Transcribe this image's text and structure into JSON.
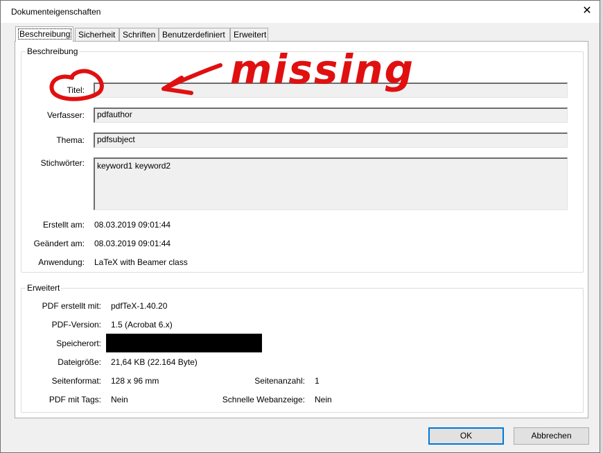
{
  "window": {
    "title": "Dokumenteigenschaften",
    "close_glyph": "✕"
  },
  "tabs": [
    "Beschreibung",
    "Sicherheit",
    "Schriften",
    "Benutzerdefiniert",
    "Erweitert"
  ],
  "description": {
    "group_title": "Beschreibung",
    "title_label": "Titel:",
    "title_value": "",
    "author_label": "Verfasser:",
    "author_value": "pdfauthor",
    "subject_label": "Thema:",
    "subject_value": "pdfsubject",
    "keywords_label": "Stichwörter:",
    "keywords_value": "keyword1 keyword2",
    "created_label": "Erstellt am:",
    "created_value": "08.03.2019 09:01:44",
    "modified_label": "Geändert am:",
    "modified_value": "08.03.2019 09:01:44",
    "application_label": "Anwendung:",
    "application_value": "LaTeX with Beamer class"
  },
  "advanced": {
    "group_title": "Erweitert",
    "producer_label": "PDF erstellt mit:",
    "producer_value": "pdfTeX-1.40.20",
    "version_label": "PDF-Version:",
    "version_value": "1.5 (Acrobat 6.x)",
    "location_label": "Speicherort:",
    "size_label": "Dateigröße:",
    "size_value": "21,64 KB (22.164 Byte)",
    "page_format_label": "Seitenformat:",
    "page_format_value": "128 x 96 mm",
    "page_count_label": "Seitenanzahl:",
    "page_count_value": "1",
    "tagged_label": "PDF mit Tags:",
    "tagged_value": "Nein",
    "fast_web_label": "Schnelle Webanzeige:",
    "fast_web_value": "Nein"
  },
  "buttons": {
    "ok": "OK",
    "cancel": "Abbrechen"
  },
  "annotation": {
    "text": "missing",
    "color": "#e01010"
  },
  "colors": {
    "focus_border": "#0078d7",
    "dialog_bg": "#f0f0f0",
    "redaction": "#000000"
  }
}
